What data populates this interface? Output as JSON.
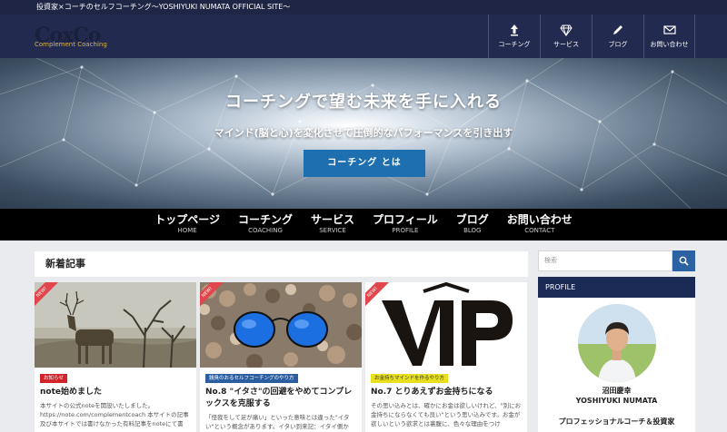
{
  "site": {
    "tagline": "投資家×コーチのセルフコーチング〜YOSHIYUKI NUMATA OFFICIAL SITE〜",
    "logo_main": "CoxCo",
    "logo_sub": "Complement Coaching"
  },
  "header_nav": [
    {
      "label": "コーチング",
      "icon": "upload-arrow-icon"
    },
    {
      "label": "サービス",
      "icon": "diamond-icon"
    },
    {
      "label": "ブログ",
      "icon": "pencil-icon"
    },
    {
      "label": "お問い合わせ",
      "icon": "mail-icon"
    }
  ],
  "hero": {
    "title": "コーチングで望む未来を手に入れる",
    "subtitle": "マインド(脳と心)を変化させて圧倒的なパフォーマンスを引き出す",
    "button": "コーチング とは"
  },
  "main_nav": [
    {
      "jp": "トップページ",
      "en": "HOME"
    },
    {
      "jp": "コーチング",
      "en": "COACHING"
    },
    {
      "jp": "サービス",
      "en": "SERVICE"
    },
    {
      "jp": "プロフィール",
      "en": "PROFILE"
    },
    {
      "jp": "ブログ",
      "en": "BLOG"
    },
    {
      "jp": "お問い合わせ",
      "en": "CONTACT"
    }
  ],
  "posts_section": {
    "heading": "新着記事",
    "new_badge": "NEW!",
    "posts": [
      {
        "category": "お知らせ",
        "category_color": "#d2232a",
        "title": "note始めました",
        "excerpt": "本サイトの公式noteを開設いたしました。https://note.com/complementcoach 本サイトの記事及び本サイトでは書けなかった有料記事をnoteにて書"
      },
      {
        "category": "銭臭のおるセルフコーチングのやり方",
        "category_color": "#2a5ea0",
        "title": "No.8 \"イタさ\"の回避をやめてコンプレックスを克服する",
        "excerpt": "「怪我をして足が痛い」といった意味とは違った\"イタい\"という概念があります。イタい到来記：イタイ側か"
      },
      {
        "category": "お金持ちマインドを作るやり方",
        "category_color": "#e8e01c",
        "title": "No.7 とりあえずお金持ちになる",
        "excerpt": "その思い込みとは、確かにお金は欲しいけれど、\"別にお金持ちにならなくても良い\"という思い込みです。お金が欲しいという欲求とは裏腹に、色々な理由をつけ"
      }
    ]
  },
  "sidebar": {
    "search_placeholder": "検索",
    "profile_heading": "PROFILE",
    "profile_name_jp": "沼田慶幸",
    "profile_name_en": "YOSHIYUKI NUMATA",
    "profile_role": "プロフェッショナルコーチ＆投資家"
  }
}
